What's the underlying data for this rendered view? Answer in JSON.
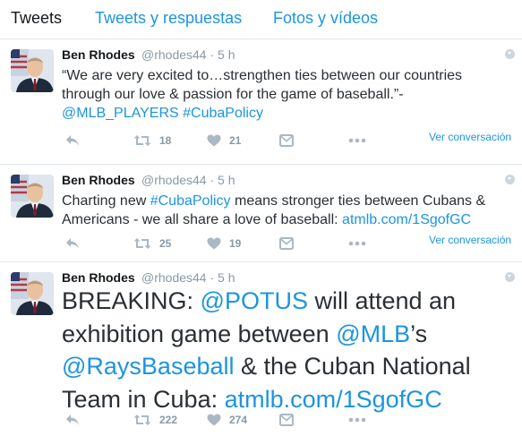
{
  "tabs": [
    "Tweets",
    "Tweets y respuestas",
    "Fotos y vídeos"
  ],
  "tweets": [
    {
      "name": "Ben Rhodes",
      "handle_time": "@rhodes44 · 5 h",
      "parts": [
        {
          "t": "“We are very excited to…strengthen ties between our countries through our love & passion for the game of baseball.”- ",
          "link": false
        },
        {
          "t": "@MLB_PLAYERS",
          "link": true
        },
        {
          "t": " ",
          "link": false
        },
        {
          "t": "#CubaPolicy",
          "link": true
        }
      ],
      "retweets": "18",
      "likes": "21",
      "view": "Ver conversación"
    },
    {
      "name": "Ben Rhodes",
      "handle_time": "@rhodes44 · 5 h",
      "parts": [
        {
          "t": "Charting new ",
          "link": false
        },
        {
          "t": "#CubaPolicy",
          "link": true
        },
        {
          "t": " means stronger ties between Cubans & Americans - we all share a love of baseball: ",
          "link": false
        },
        {
          "t": "atmlb.com/1SgofGC",
          "link": true
        }
      ],
      "retweets": "25",
      "likes": "19",
      "view": "Ver conversación"
    },
    {
      "name": "Ben Rhodes",
      "handle_time": "@rhodes44 · 5 h",
      "parts": [
        {
          "t": "BREAKING: ",
          "link": false
        },
        {
          "t": "@POTUS",
          "link": true
        },
        {
          "t": " will attend an exhibition game between ",
          "link": false
        },
        {
          "t": "@MLB",
          "link": true
        },
        {
          "t": "’s ",
          "link": false
        },
        {
          "t": "@RaysBaseball",
          "link": true
        },
        {
          "t": " & the Cuban National Team in Cuba: ",
          "link": false
        },
        {
          "t": "atmlb.com/1SgofGC",
          "link": true
        }
      ],
      "retweets": "222",
      "likes": "274",
      "view": ""
    }
  ],
  "icons": {
    "avatar": "profile-photo",
    "reply": "reply-icon",
    "retweet": "retweet-icon",
    "like": "heart-icon",
    "dm": "direct-message-icon",
    "more": "more-icon",
    "caret": "chevron-down-icon"
  },
  "colors": {
    "link": "#1b95e0",
    "icon": "#aab8c2",
    "muted": "#8899a6",
    "border": "#e1e8ed"
  }
}
